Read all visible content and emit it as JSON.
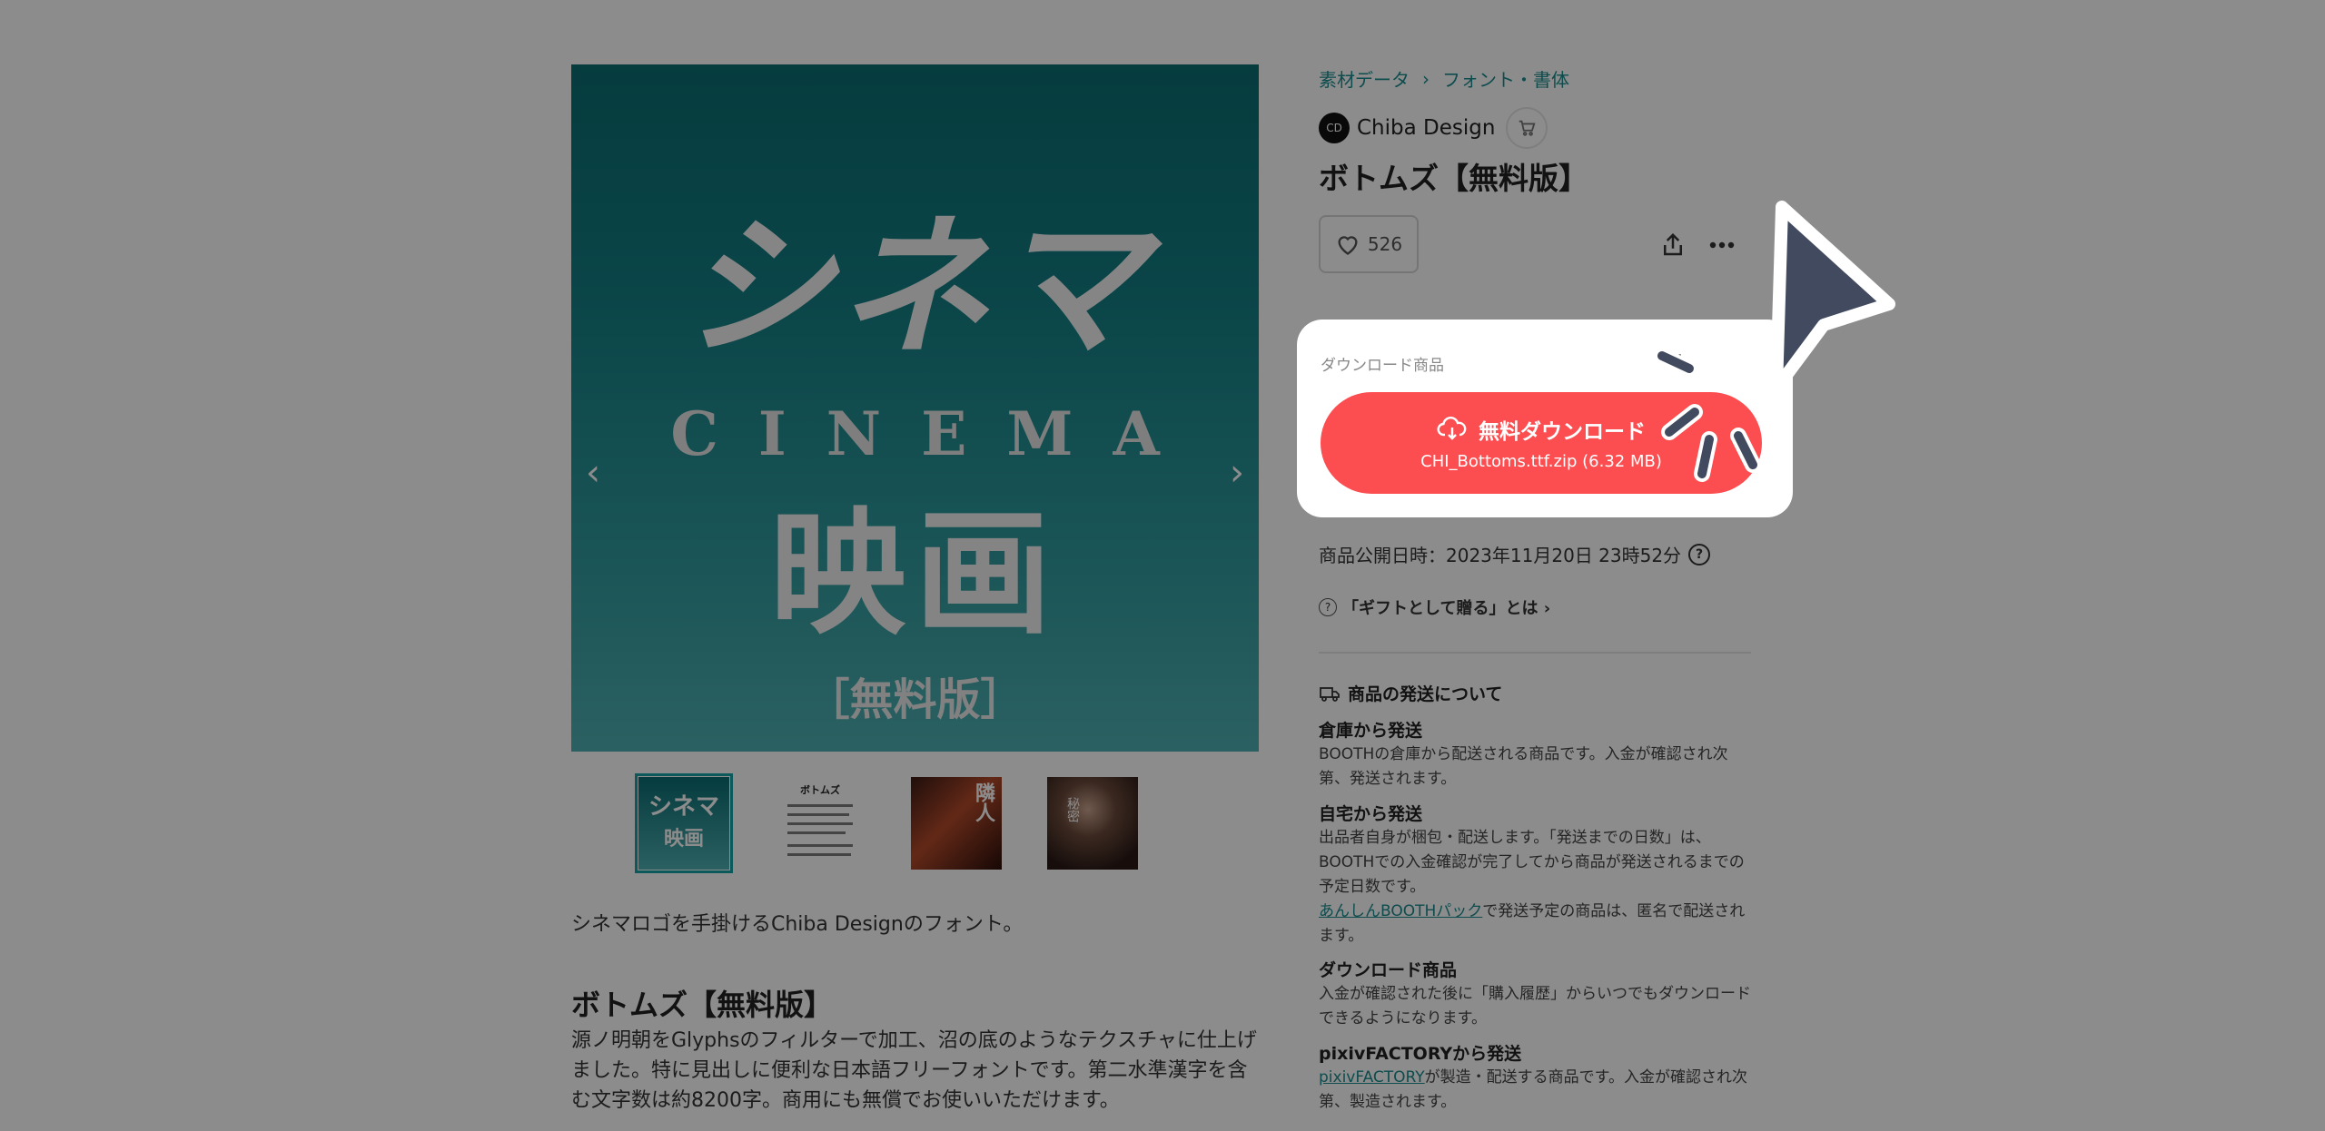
{
  "product_image": {
    "kana": "シネマ",
    "latin": "CINEMA",
    "kanji": "映画",
    "free_label": "［無料版］"
  },
  "carousel": {
    "prev": "‹",
    "next": "›"
  },
  "thumbnails": [
    {
      "name": "thumb-cinema",
      "line1": "シネマ",
      "line2": "映画"
    },
    {
      "name": "thumb-bottoms-specimen",
      "line1": "ボトムズ"
    },
    {
      "name": "thumb-sample-1",
      "line1": "隣人"
    },
    {
      "name": "thumb-sample-2",
      "line1": "秘密"
    }
  ],
  "description": {
    "lead": "シネマロゴを手掛けるChiba Designのフォント。",
    "heading": "ボトムズ【無料版】",
    "body": "源ノ明朝をGlyphsのフィルターで加工、沼の底のようなテクスチャに仕上げました。特に見出しに便利な日本語フリーフォントです。第二水準漢字を含む文字数は約8200字。商用にも無償でお使いいただけます。"
  },
  "breadcrumb": {
    "category": "素材データ",
    "sep": "›",
    "subcategory": "フォント・書体"
  },
  "shop": {
    "name": "Chiba Design",
    "avatar_text": "CD"
  },
  "product": {
    "title": "ボトムズ【無料版】",
    "likes": "526"
  },
  "download": {
    "label": "ダウンロード商品",
    "price": "¥",
    "button_label": "無料ダウンロード",
    "file": "CHI_Bottoms.ttf.zip (6.32 MB)"
  },
  "publish": {
    "text": "商品公開日時：2023年11月20日 23時52分",
    "help": "?"
  },
  "gift": {
    "text": "「ギフトとして贈る」とは ›",
    "icon": "?"
  },
  "shipping": {
    "heading": "商品の発送について",
    "warehouse_title": "倉庫から発送",
    "warehouse_text": "BOOTHの倉庫から配送される商品です。入金が確認され次第、発送されます。",
    "home_title": "自宅から発送",
    "home_text": "出品者自身が梱包・配送します。「発送までの日数」は、BOOTHでの入金確認が完了してから商品が発送されるまでの予定日数です。",
    "anshin_link": "あんしんBOOTHパック",
    "anshin_text": "で発送予定の商品は、匿名で配送されます。",
    "download_title": "ダウンロード商品",
    "download_text": "入金が確認された後に「購入履歴」からいつでもダウンロードできるようになります。",
    "factory_title": "pixivFACTORYから発送",
    "factory_link": "pixivFACTORY",
    "factory_text": "が製造・配送する商品です。入金が確認され次第、製造されます。"
  },
  "colors": {
    "accent": "#1a8a8d",
    "download_button": "#fc4d50",
    "pointer": "#414a5e",
    "overlay": "rgba(0,0,0,0.45)"
  },
  "icons": [
    "heart-icon",
    "share-icon",
    "more-icon",
    "cart-icon",
    "cloud-download-icon",
    "help-icon",
    "truck-icon",
    "pointer-cursor-icon"
  ]
}
